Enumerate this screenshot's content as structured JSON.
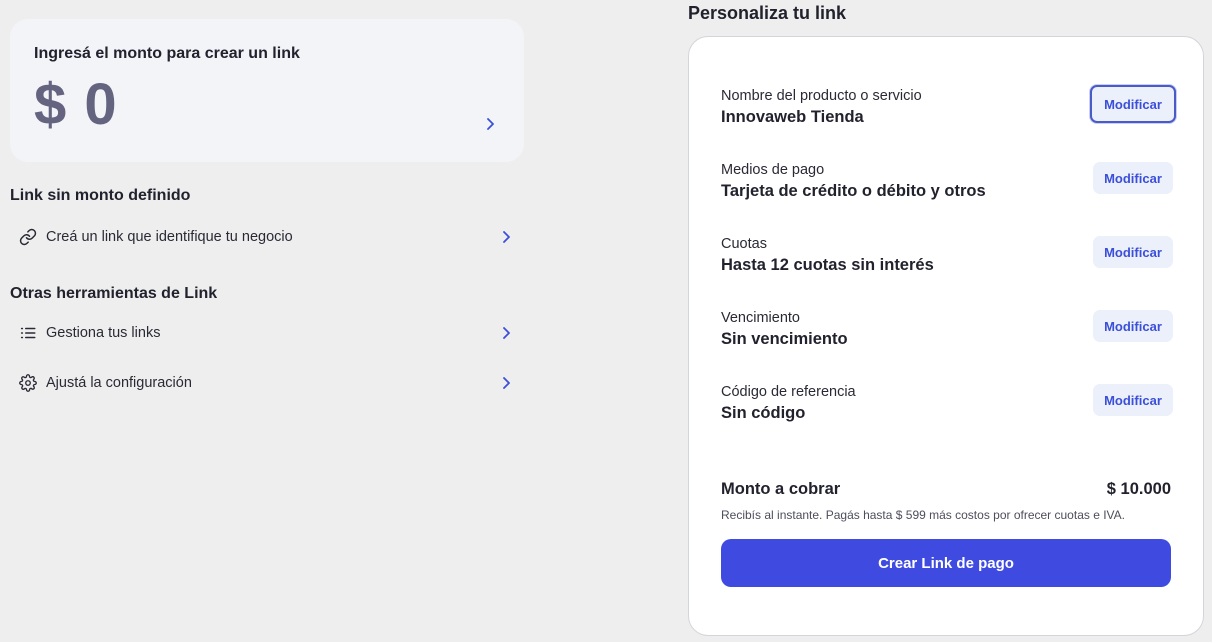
{
  "amount_card": {
    "prompt": "Ingresá el monto para crear un link",
    "value": "$ 0"
  },
  "no_amount": {
    "title": "Link sin monto definido",
    "items": [
      {
        "label": "Creá un link que identifique tu negocio",
        "icon": "link-icon"
      }
    ]
  },
  "other_tools": {
    "title": "Otras herramientas de Link",
    "items": [
      {
        "label": "Gestiona tus links",
        "icon": "list-icon"
      },
      {
        "label": "Ajustá la configuración",
        "icon": "gear-icon"
      }
    ]
  },
  "customize": {
    "title": "Personaliza tu link",
    "button_label": "Modificar",
    "fields": [
      {
        "label": "Nombre del producto o servicio",
        "value": "Innovaweb Tienda"
      },
      {
        "label": "Medios de pago",
        "value": "Tarjeta de crédito o débito y otros"
      },
      {
        "label": "Cuotas",
        "value": "Hasta 12 cuotas sin interés"
      },
      {
        "label": "Vencimiento",
        "value": "Sin vencimiento"
      },
      {
        "label": "Código de referencia",
        "value": "Sin código"
      }
    ],
    "total_label": "Monto a cobrar",
    "total_value": "$ 10.000",
    "total_note": "Recibís al instante. Pagás hasta $ 599 más costos por ofrecer cuotas e IVA.",
    "cta_label": "Crear Link de pago"
  },
  "colors": {
    "accent": "#3f4be0",
    "amount_text": "#646481",
    "card_bg": "#f3f4f8",
    "page_bg": "#eeeeee"
  }
}
